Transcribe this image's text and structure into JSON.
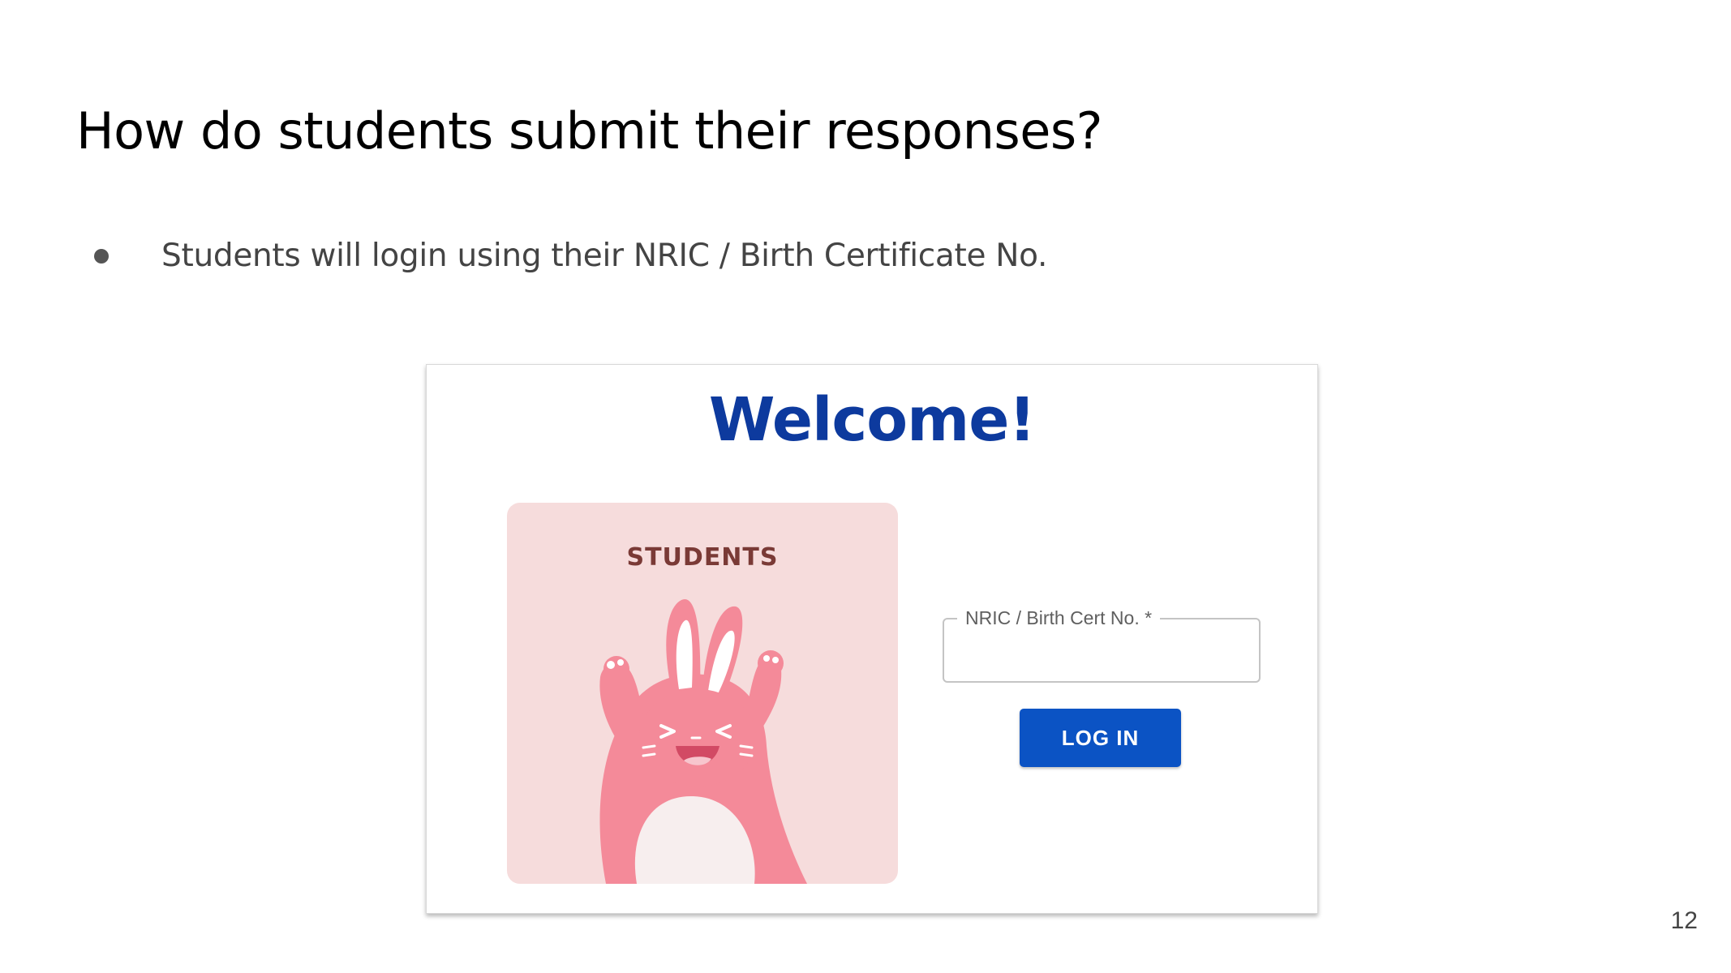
{
  "slide": {
    "title": "How do students submit their responses?",
    "bullets": [
      "Students will login using their NRIC / Birth Certificate No."
    ],
    "page_number": "12"
  },
  "login_screen": {
    "welcome": "Welcome!",
    "panel_label": "STUDENTS",
    "panel_illustration": "bunny-illustration",
    "nric_field": {
      "label": "NRIC / Birth Cert No. *",
      "value": ""
    },
    "login_button_label": "LOG IN",
    "colors": {
      "welcome": "#0d3a9e",
      "button": "#0b53c4",
      "panel_background": "#f6dcdc",
      "bunny": "#f48a99"
    }
  }
}
